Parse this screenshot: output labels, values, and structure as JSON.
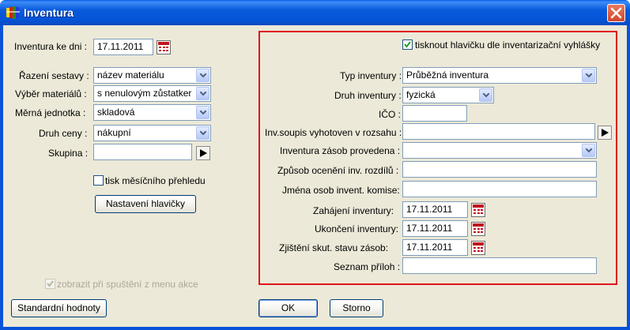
{
  "window": {
    "title": "Inventura"
  },
  "left": {
    "inventura_ke_dni_label": "Inventura ke dni :",
    "inventura_ke_dni_value": "17.11.2011",
    "razeni_label": "Řazení sestavy :",
    "razeni_value": "název materiálu",
    "vyber_label": "Výběr materiálů :",
    "vyber_value": "s nenulovým zůstatker",
    "merna_label": "Měrná jednotka :",
    "merna_value": "skladová",
    "druh_ceny_label": "Druh ceny :",
    "druh_ceny_value": "nákupní",
    "skupina_label": "Skupina :",
    "skupina_value": "",
    "tisk_label": "tisk měsíčního přehledu",
    "tisk_checked": false,
    "nastaveni_button": "Nastavení hlavičky",
    "zobrazit_label": "zobrazit při spuštění z menu akce",
    "zobrazit_checked": true
  },
  "right": {
    "tisknout_label": "tisknout hlavičku dle inventarizační vyhlášky",
    "tisknout_checked": true,
    "typ_label": "Typ inventury :",
    "typ_value": "Průběžná inventura",
    "druh_label": "Druh inventury :",
    "druh_value": "fyzická",
    "ico_label": "IČO :",
    "ico_value": "",
    "soupis_label": "Inv.soupis vyhotoven v rozsahu :",
    "soupis_value": "",
    "provedena_label": "Inventura zásob provedena :",
    "provedena_value": "",
    "zpusob_label": "Způsob ocenění inv. rozdílů :",
    "zpusob_value": "",
    "jmena_label": "Jména osob invent. komise:",
    "jmena_value": "",
    "zahajeni_label": "Zahájení inventury:",
    "zahajeni_value": "17.11.2011",
    "ukonceni_label": "Ukončení inventury:",
    "ukonceni_value": "17.11.2011",
    "zjisteni_label": "Zjištění skut. stavu zásob:",
    "zjisteni_value": "17.11.2011",
    "seznam_label": "Seznam příloh :",
    "seznam_value": ""
  },
  "buttons": {
    "standard": "Standardní hodnoty",
    "ok": "OK",
    "storno": "Storno"
  },
  "colors": {
    "titlebar": "#0a5adc",
    "highlight_frame": "#e0141e",
    "face": "#ece9d8"
  },
  "icons": {
    "app": "app-icon",
    "close": "close-icon",
    "calendar": "calendar-icon",
    "play": "play-icon",
    "dropdown": "chevron-down-icon"
  }
}
